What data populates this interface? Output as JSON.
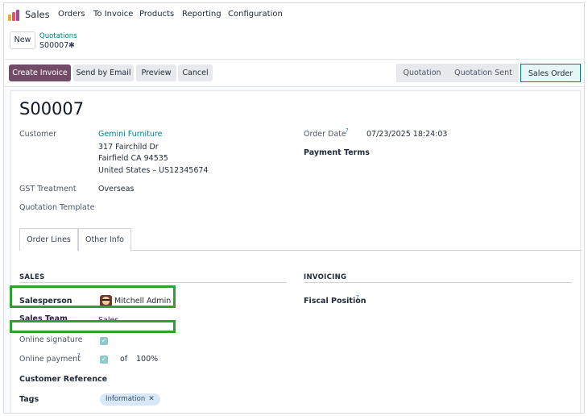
{
  "topnav": {
    "app_name": "Sales",
    "menu": [
      "Orders",
      "To Invoice",
      "Products",
      "Reporting",
      "Configuration"
    ]
  },
  "control_panel": {
    "new_label": "New",
    "breadcrumb_parent": "Quotations",
    "breadcrumb_current": "S00007"
  },
  "actions": {
    "create_invoice": "Create Invoice",
    "send_by_email": "Send by Email",
    "preview": "Preview",
    "cancel": "Cancel"
  },
  "status": {
    "stages": [
      "Quotation",
      "Quotation Sent",
      "Sales Order"
    ],
    "active": "Sales Order"
  },
  "record": {
    "title": "S00007",
    "customer_label": "Customer",
    "customer_name": "Gemini Furniture",
    "address_line1": "317 Fairchild Dr",
    "address_line2": "Fairfield CA 94535",
    "address_line3": "United States – US12345674",
    "gst_label": "GST Treatment",
    "gst_value": "Overseas",
    "quotation_template_label": "Quotation Template",
    "order_date_label": "Order Date",
    "order_date_value": "07/23/2025 18:24:03",
    "payment_terms_label": "Payment Terms"
  },
  "tabs": [
    "Order Lines",
    "Other Info"
  ],
  "active_tab": "Other Info",
  "other_info": {
    "sales_section": "SALES",
    "invoicing_section": "INVOICING",
    "salesperson_label": "Salesperson",
    "salesperson_value": "Mitchell Admin",
    "sales_team_label": "Sales Team",
    "sales_team_value": "Sales",
    "online_signature_label": "Online signature",
    "online_signature_checked": true,
    "online_payment_label": "Online payment",
    "online_payment_checked": true,
    "online_payment_of": "of",
    "online_payment_percent": "100%",
    "customer_reference_label": "Customer Reference",
    "tags_label": "Tags",
    "tags": [
      "Information"
    ],
    "fiscal_position_label": "Fiscal Position"
  },
  "colors": {
    "brand": "#714b67",
    "link": "#017e84",
    "highlight": "#2ea12e"
  }
}
